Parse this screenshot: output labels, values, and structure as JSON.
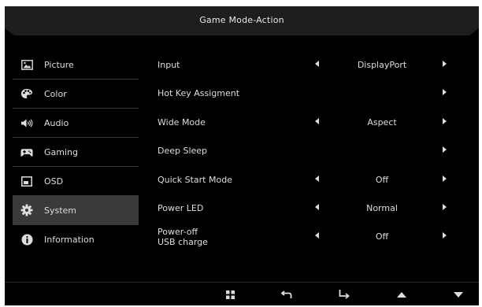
{
  "header": {
    "title": "Game Mode-Action"
  },
  "sidebar": {
    "items": [
      {
        "label": "Picture",
        "icon": "picture-icon",
        "active": false
      },
      {
        "label": "Color",
        "icon": "palette-icon",
        "active": false
      },
      {
        "label": "Audio",
        "icon": "speaker-icon",
        "active": false
      },
      {
        "label": "Gaming",
        "icon": "gamepad-icon",
        "active": false
      },
      {
        "label": "OSD",
        "icon": "osd-window-icon",
        "active": false
      },
      {
        "label": "System",
        "icon": "gear-icon",
        "active": true
      },
      {
        "label": "Information",
        "icon": "info-icon",
        "active": false
      }
    ]
  },
  "settings": [
    {
      "label": "Input",
      "value": "DisplayPort",
      "has_left": true
    },
    {
      "label": "Hot Key Assigment",
      "value": "",
      "has_left": false
    },
    {
      "label": "Wide Mode",
      "value": "Aspect",
      "has_left": true
    },
    {
      "label": "Deep Sleep",
      "value": "",
      "has_left": false
    },
    {
      "label": "Quick Start Mode",
      "value": "Off",
      "has_left": true
    },
    {
      "label": "Power LED",
      "value": "Normal",
      "has_left": true
    },
    {
      "label": "Power-off\nUSB charge",
      "label_line1": "Power-off",
      "label_line2": "USB charge",
      "value": "Off",
      "has_left": true
    }
  ],
  "nav_buttons": [
    "menu-grid-icon",
    "back-icon",
    "enter-icon",
    "up-icon",
    "down-icon"
  ],
  "colors": {
    "background": "#000000",
    "active_item": "#3a3a3a",
    "text": "#dddddd",
    "divider": "#3a3a3a"
  }
}
